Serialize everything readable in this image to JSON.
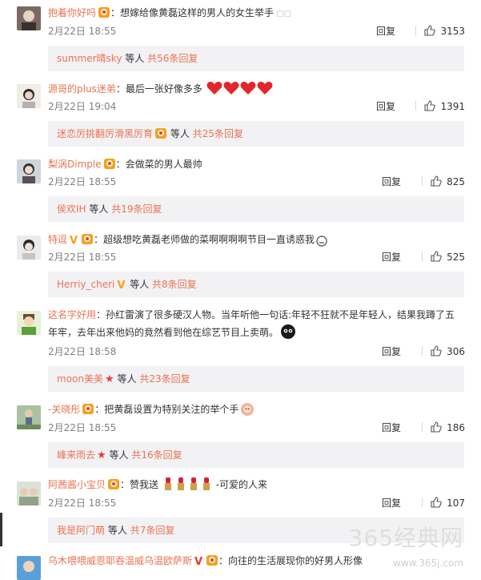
{
  "ui": {
    "reply_label": "回复",
    "sub_others": "等人",
    "colors": {
      "username": "#eb7350",
      "meta": "#808080",
      "sub_bg": "#f2f2f5"
    }
  },
  "comments": [
    {
      "username": "抱着你好吗",
      "text": "：想嫁给像黄磊这样的男人的女生举手",
      "time": "2月22日 18:55",
      "likes": "3153",
      "sub": {
        "name": "summer晴sky",
        "total": "共56条回复"
      }
    },
    {
      "username": "源哥的plus迷弟",
      "text": "：最后一张好像多多",
      "time": "2月22日 19:04",
      "likes": "1391",
      "sub": {
        "name": "迷恋厉挑翻厉滑黑厉育",
        "total": "共25条回复"
      }
    },
    {
      "username": "梨涡Dimple",
      "text": "：会做菜的男人最帅",
      "time": "2月22日 18:55",
      "likes": "825",
      "sub": {
        "name": "侯欢IH",
        "total": "共19条回复"
      }
    },
    {
      "username": "特逗",
      "text": "：超级想吃黄磊老师做的菜啊啊啊啊节目一直诱惑我",
      "time": "2月22日 18:55",
      "likes": "525",
      "sub": {
        "name": "Herriy_cheri",
        "total": "共8条回复"
      }
    },
    {
      "username": "这名字好用",
      "text": "：孙红雷演了很多硬汉人物。当年听他一句话:年轻不狂就不是年轻人，结果我蹲了五",
      "text2": "年牢，去年出来他妈的竟然看到他在综艺节目上卖萌。",
      "time": "2月22日 18:58",
      "likes": "306",
      "sub": {
        "name": "moon美美",
        "total": "共23条回复"
      }
    },
    {
      "username": "-关晓彤",
      "text": "：把黄磊设置为特别关注的举个手",
      "time": "2月22日 18:55",
      "likes": "186",
      "sub": {
        "name": "峰来雨去",
        "total": "共16条回复"
      }
    },
    {
      "username": "阿茜酱小宝贝",
      "text": "：赞我送",
      "text_after": "-可爱的人来",
      "time": "2月22日 18:55",
      "likes": "107",
      "sub": {
        "name": "我是阿门萌",
        "total": "共7条回复"
      }
    },
    {
      "username": "乌木喂喂威恩耶吞温威乌温欧萨斯",
      "text": "：向往的生活展现你的好男人形像"
    }
  ],
  "watermark": {
    "main": "365经典网",
    "sub": "www.365j.com"
  }
}
